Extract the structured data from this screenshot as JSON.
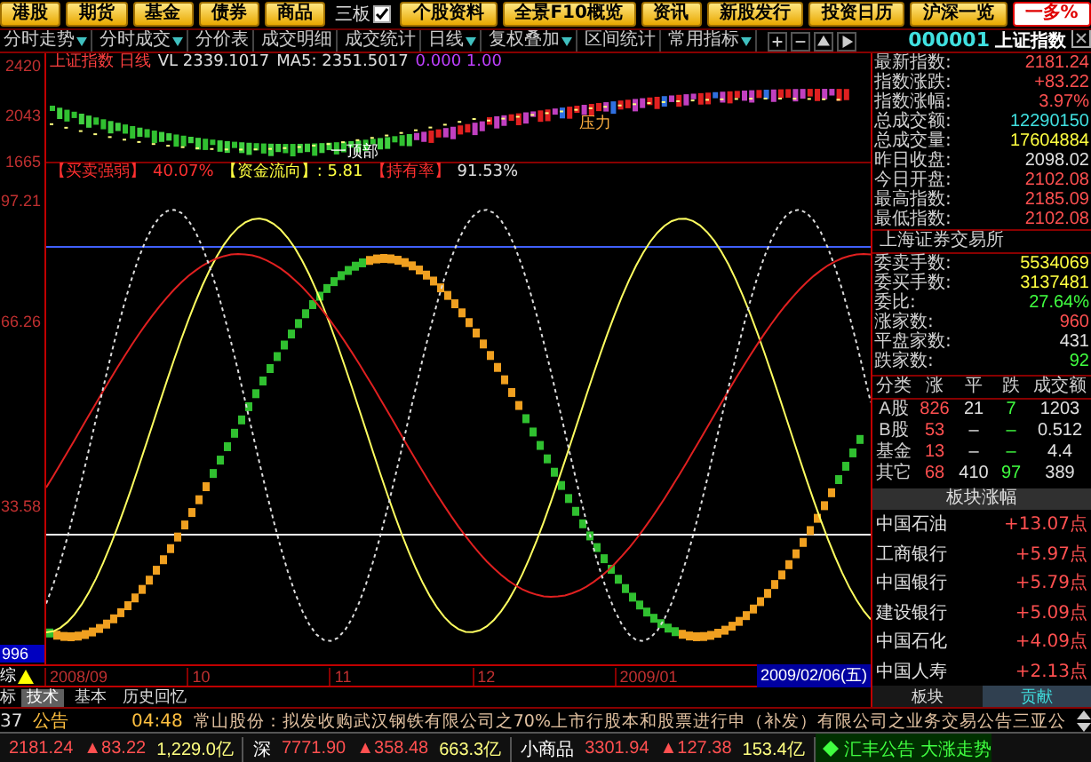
{
  "top_menu": [
    {
      "label": "港股",
      "kind": "button"
    },
    {
      "label": "期货",
      "kind": "button"
    },
    {
      "label": "基金",
      "kind": "button"
    },
    {
      "label": "债券",
      "kind": "button"
    },
    {
      "label": "商品",
      "kind": "button"
    },
    {
      "label": "三板",
      "kind": "checkbox",
      "checked": true
    },
    {
      "label": "个股资料",
      "kind": "button"
    },
    {
      "label": "全景F10概览",
      "kind": "button"
    },
    {
      "label": "资讯",
      "kind": "button"
    },
    {
      "label": "新股发行",
      "kind": "button"
    },
    {
      "label": "投资日历",
      "kind": "button"
    },
    {
      "label": "沪深一览",
      "kind": "button"
    },
    {
      "label": "一多%",
      "kind": "alert"
    }
  ],
  "toolbar": {
    "items": [
      {
        "label": "分时走势",
        "dropdown": true
      },
      {
        "label": "分时成交",
        "dropdown": true
      },
      {
        "label": "分价表",
        "dropdown": false
      },
      {
        "label": "成交明细",
        "dropdown": false
      },
      {
        "label": "成交统计",
        "dropdown": false
      },
      {
        "label": "日线",
        "dropdown": true
      },
      {
        "label": "复权叠加",
        "dropdown": true
      },
      {
        "label": "区间统计",
        "dropdown": false
      },
      {
        "label": "常用指标",
        "dropdown": true
      }
    ],
    "security": {
      "code": "000001",
      "name": "上证指数"
    }
  },
  "price_chart": {
    "header": [
      {
        "text": "上证指数 日线",
        "color": "#ff4040"
      },
      {
        "text": "VL 2339.1017",
        "color": "#e0e0e0"
      },
      {
        "text": "MA5: 2351.5017",
        "color": "#e0e0e0"
      },
      {
        "text": "0.000 1.00",
        "color": "#c040ff"
      }
    ],
    "axis_labels": [
      "2420",
      "2043",
      "1665"
    ],
    "annotations": [
      "压力",
      "一顶部"
    ]
  },
  "indicator_chart": {
    "header": [
      {
        "text": "【买卖强弱】",
        "color": "#ff3030"
      },
      {
        "text": "40.07%",
        "color": "#ff3030"
      },
      {
        "text": "【资金流向】: 5.81",
        "color": "#ffff40"
      },
      {
        "text": "【持有率】",
        "color": "#ff3030"
      },
      {
        "text": "91.53%",
        "color": "#e0e0e0"
      }
    ],
    "axis_labels": [
      "97.21",
      "66.26",
      "33.58"
    ],
    "cursor_value": "996"
  },
  "x_axis": {
    "prefix": "综",
    "labels": [
      "2008/09",
      "10",
      "11",
      "12",
      "2009/01"
    ],
    "cursor_date": "2009/02/06(五)"
  },
  "bottom_tabs": {
    "prefix": "标",
    "tabs": [
      {
        "label": "技术",
        "selected": true
      },
      {
        "label": "基本",
        "selected": false
      },
      {
        "label": "历史回忆",
        "selected": false
      }
    ]
  },
  "quote_panel": {
    "rows": [
      {
        "label": "最新指数:",
        "value": "2181.24",
        "color": "#ff5050"
      },
      {
        "label": "指数涨跌:",
        "value": "+83.22",
        "color": "#ff5050"
      },
      {
        "label": "指数涨幅:",
        "value": "3.97%",
        "color": "#ff5050"
      },
      {
        "label": "总成交额:",
        "value": "12290150",
        "color": "#40e0e0"
      },
      {
        "label": "总成交量:",
        "value": "17604884",
        "color": "#ffff40"
      },
      {
        "label": "昨日收盘:",
        "value": "2098.02",
        "color": "#e0e0e0"
      },
      {
        "label": "今日开盘:",
        "value": "2102.08",
        "color": "#ff5050"
      },
      {
        "label": "最高指数:",
        "value": "2185.09",
        "color": "#ff5050"
      },
      {
        "label": "最低指数:",
        "value": "2102.08",
        "color": "#ff5050"
      }
    ],
    "exchange": "上海证券交易所",
    "exchange_rows": [
      {
        "label": "委卖手数:",
        "value": "5534069",
        "color": "#ffff40"
      },
      {
        "label": "委买手数:",
        "value": "3137481",
        "color": "#ffff40"
      },
      {
        "label": "委比:",
        "value": "27.64%",
        "color": "#40ff40"
      },
      {
        "label": "涨家数:",
        "value": "960",
        "color": "#ff5050"
      },
      {
        "label": "平盘家数:",
        "value": "431",
        "color": "#e0e0e0"
      },
      {
        "label": "跌家数:",
        "value": "92",
        "color": "#40ff40"
      }
    ],
    "table": {
      "columns": [
        "分类",
        "涨",
        "平",
        "跌",
        "成交额"
      ],
      "rows": [
        [
          "A股",
          "826",
          "21",
          "7",
          "1203"
        ],
        [
          "B股",
          "53",
          "–",
          "–",
          "0.512"
        ],
        [
          "基金",
          "13",
          "–",
          "–",
          "4.4"
        ],
        [
          "其它",
          "68",
          "410",
          "97",
          "389"
        ]
      ]
    },
    "contrib_title": "板块涨幅",
    "contributors": [
      {
        "name": "中国石油",
        "value": "+13.07点"
      },
      {
        "name": "工商银行",
        "value": "+5.97点"
      },
      {
        "name": "中国银行",
        "value": "+5.79点"
      },
      {
        "name": "建设银行",
        "value": "+5.09点"
      },
      {
        "name": "中国石化",
        "value": "+4.09点"
      },
      {
        "name": "中国人寿",
        "value": "+2.13点"
      }
    ],
    "tabs": [
      {
        "label": "板块",
        "selected": false
      },
      {
        "label": "贡献",
        "selected": true
      }
    ]
  },
  "news": {
    "channel": "37",
    "category": "公告",
    "time": "04:48",
    "headline": "常山股份：拟发收购武汉钢铁有限公司之70%上市行股本和股票进行申（补发）有限公司之业务交易公告三亚公"
  },
  "status_bar": {
    "items": [
      {
        "value": "2181.24",
        "change": "▲83.22",
        "amount": "1,229.0亿"
      },
      {
        "label": "深",
        "value": "7771.90",
        "change": "▲358.48",
        "amount": "663.3亿"
      },
      {
        "label": "小商品",
        "value": "3301.94",
        "change": "▲127.38",
        "amount": "153.4亿"
      }
    ],
    "ticker": "汇丰公告 大涨走势"
  }
}
